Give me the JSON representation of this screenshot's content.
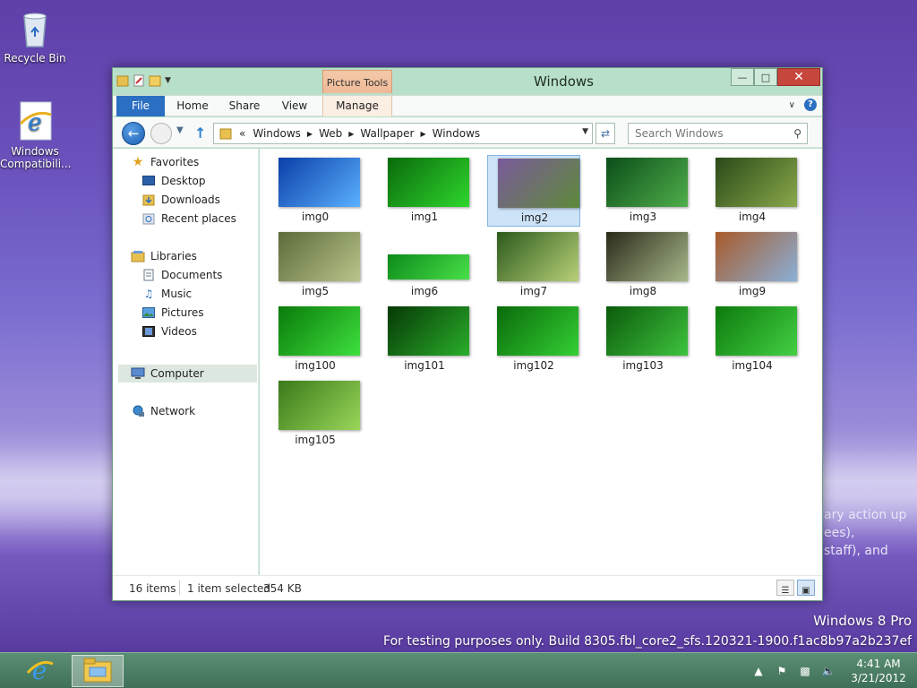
{
  "desktop": {
    "icons": [
      {
        "label": "Recycle Bin"
      },
      {
        "label": "Windows Compatibili..."
      }
    ],
    "background_text": [
      "ary action up",
      "ees),",
      "staff), and"
    ],
    "watermark": {
      "edition": "Windows 8 Pro",
      "build": "For testing purposes only. Build 8305.fbl_core2_sfs.120321-1900.f1ac8b97a2b237ef"
    }
  },
  "window": {
    "title": "Windows",
    "context_tab_group": "Picture Tools",
    "ribbon_tabs": [
      "File",
      "Home",
      "Share",
      "View",
      "Manage"
    ],
    "address": {
      "overflow": "«",
      "crumbs": [
        "Windows",
        "Web",
        "Wallpaper",
        "Windows"
      ]
    },
    "search": {
      "placeholder": "Search Windows"
    },
    "nav_pane": {
      "favorites": "Favorites",
      "desktop": "Desktop",
      "downloads": "Downloads",
      "recent": "Recent places",
      "libraries": "Libraries",
      "documents": "Documents",
      "music": "Music",
      "pictures": "Pictures",
      "videos": "Videos",
      "computer": "Computer",
      "network": "Network"
    },
    "files": [
      {
        "name": "img0",
        "colors": [
          "#0b3fa8",
          "#5ab0ff"
        ]
      },
      {
        "name": "img1",
        "colors": [
          "#0a6a0a",
          "#2ed62e"
        ]
      },
      {
        "name": "img2",
        "colors": [
          "#7a5a9a",
          "#5e8a3a"
        ]
      },
      {
        "name": "img3",
        "colors": [
          "#0c4e1a",
          "#4fae4a"
        ]
      },
      {
        "name": "img4",
        "colors": [
          "#2a4a1a",
          "#8aa84a"
        ]
      },
      {
        "name": "img5",
        "colors": [
          "#5c6a3a",
          "#b8c48a"
        ]
      },
      {
        "name": "img6",
        "colors": [
          "#0c8a1a",
          "#48e048"
        ]
      },
      {
        "name": "img7",
        "colors": [
          "#2c5a1c",
          "#b8d078"
        ]
      },
      {
        "name": "img8",
        "colors": [
          "#2a2a1a",
          "#a8b88a"
        ]
      },
      {
        "name": "img9",
        "colors": [
          "#a85a2a",
          "#8ab0d8"
        ]
      },
      {
        "name": "img100",
        "colors": [
          "#0a7a0a",
          "#3ee03e"
        ]
      },
      {
        "name": "img101",
        "colors": [
          "#063806",
          "#2aae2a"
        ]
      },
      {
        "name": "img102",
        "colors": [
          "#0a6a0a",
          "#34d034"
        ]
      },
      {
        "name": "img103",
        "colors": [
          "#0b5a0b",
          "#3ec43e"
        ]
      },
      {
        "name": "img104",
        "colors": [
          "#0c7a0c",
          "#44d044"
        ]
      },
      {
        "name": "img105",
        "colors": [
          "#3a7a1a",
          "#9ad65a"
        ]
      }
    ],
    "selected_file": "img2",
    "status": {
      "item_count": "16 items",
      "selection": "1 item selected",
      "size": "354 KB"
    }
  },
  "taskbar": {
    "clock": {
      "time": "4:41 AM",
      "date": "3/21/2012"
    }
  }
}
